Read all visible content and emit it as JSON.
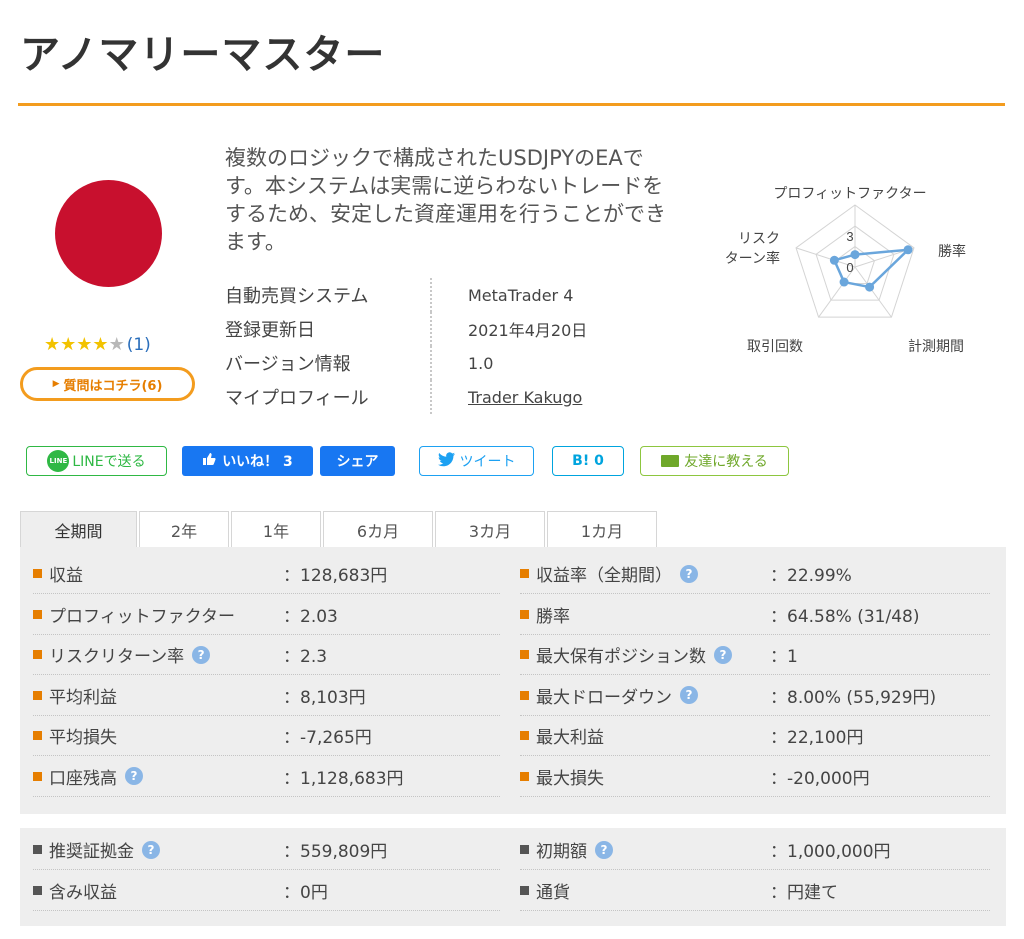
{
  "page": {
    "title": "アノマリーマスター"
  },
  "product": {
    "description": "複数のロジックで構成されたUSDJPYのEAです。本システムは実需に逆らわないトレードをするため、安定した資産運用を行うことができます。",
    "rating": {
      "stars": 4,
      "max": 5,
      "count_text": "(1)"
    },
    "question_button": "質問はコチラ(6)",
    "info": [
      {
        "label": "自動売買システム",
        "value": "MetaTrader 4",
        "link": false
      },
      {
        "label": "登録更新日",
        "value": "2021年4月20日",
        "link": false
      },
      {
        "label": "バージョン情報",
        "value": "1.0",
        "link": false
      },
      {
        "label": "マイプロフィール",
        "value": "Trader Kakugo",
        "link": true
      }
    ]
  },
  "radar": {
    "axes": [
      "プロフィットファクター",
      "勝率",
      "計測期間",
      "取引回数",
      "リスク\nターン率"
    ],
    "axis_labels": [
      "プロフィットファクター",
      "勝率",
      "計測期間",
      "取引回数",
      "リスク",
      "ターン率"
    ],
    "scale_max_label": "3",
    "scale_zero_label": "0",
    "values": [
      0.2,
      0.9,
      0.4,
      0.3,
      0.35
    ],
    "color": "#6aa6dc"
  },
  "share": {
    "line": "LINEで送る",
    "line_icon_text": "LINE",
    "facebook_like": "いいね！ 3",
    "facebook_share": "シェア",
    "tweet": "ツイート",
    "hatena": "B! 0",
    "mail": "友達に教える"
  },
  "tabs": [
    "全期間",
    "2年",
    "1年",
    "6カ月",
    "3カ月",
    "1カ月"
  ],
  "stats_left": [
    {
      "label": "収益",
      "value": "：128,683円",
      "help": false
    },
    {
      "label": "プロフィットファクター",
      "value": "：2.03",
      "help": false
    },
    {
      "label": "リスクリターン率",
      "value": "：2.3",
      "help": true
    },
    {
      "label": "平均利益",
      "value": "：8,103円",
      "help": false
    },
    {
      "label": "平均損失",
      "value": "：-7,265円",
      "help": false
    },
    {
      "label": "口座残高",
      "value": "：1,128,683円",
      "help": true
    }
  ],
  "stats_right": [
    {
      "label": "収益率（全期間）",
      "value": "：22.99%",
      "help": true
    },
    {
      "label": "勝率",
      "value": "：64.58% (31/48)",
      "help": false
    },
    {
      "label": "最大保有ポジション数",
      "value": "：1",
      "help": true
    },
    {
      "label": "最大ドローダウン",
      "value": "：8.00% (55,929円)",
      "help": true
    },
    {
      "label": "最大利益",
      "value": "：22,100円",
      "help": false
    },
    {
      "label": "最大損失",
      "value": "：-20,000円",
      "help": false
    }
  ],
  "extra_left": [
    {
      "label": "推奨証拠金",
      "value": "：559,809円",
      "help": true
    },
    {
      "label": "含み収益",
      "value": "：0円",
      "help": false
    }
  ],
  "extra_right": [
    {
      "label": "初期額",
      "value": "：1,000,000円",
      "help": true
    },
    {
      "label": "通貨",
      "value": "：円建て",
      "help": false
    }
  ],
  "help_glyph": "?",
  "colors": {
    "accent": "#f39c1e",
    "avatar": "#c8102e",
    "link": "#2a6ebb",
    "panel": "#eeeeee"
  }
}
